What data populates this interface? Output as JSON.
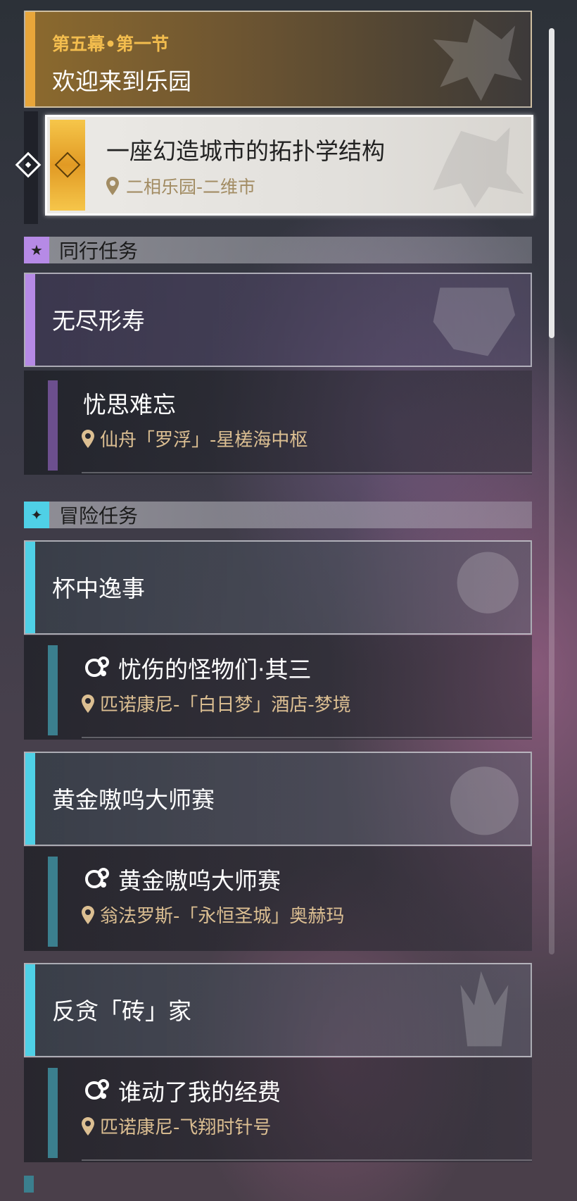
{
  "chapter": {
    "subtitle": "第五幕•第一节",
    "title": "欢迎来到乐园"
  },
  "active_quest": {
    "title": "一座幻造城市的拓扑学结构",
    "location": "二相乐园-二维市"
  },
  "sections": [
    {
      "label": "同行任务",
      "icon": "star-icon",
      "groups": [
        {
          "title": "无尽形寿",
          "accent": "#b68ae6",
          "quests": [
            {
              "title": "忧思难忘",
              "location": "仙舟「罗浮」-星槎海中枢"
            }
          ]
        }
      ]
    },
    {
      "label": "冒险任务",
      "icon": "compass-star-icon",
      "groups": [
        {
          "title": "杯中逸事",
          "accent": "#4fd0e6",
          "quests": [
            {
              "title": "忧伤的怪物们·其三",
              "location": "匹诺康尼-「白日梦」酒店-梦境"
            }
          ]
        },
        {
          "title": "黄金嗷呜大师赛",
          "accent": "#4fd0e6",
          "quests": [
            {
              "title": "黄金嗷呜大师赛",
              "location": "翁法罗斯-「永恒圣城」奥赫玛"
            }
          ]
        },
        {
          "title": "反贪「砖」家",
          "accent": "#4fd0e6",
          "quests": [
            {
              "title": "谁动了我的经费",
              "location": "匹诺康尼-飞翔时针号"
            }
          ]
        }
      ]
    }
  ],
  "colors": {
    "gold": "#e8a63a",
    "violet": "#b68ae6",
    "cyan": "#4fd0e6",
    "location_text": "#dcbf92"
  }
}
